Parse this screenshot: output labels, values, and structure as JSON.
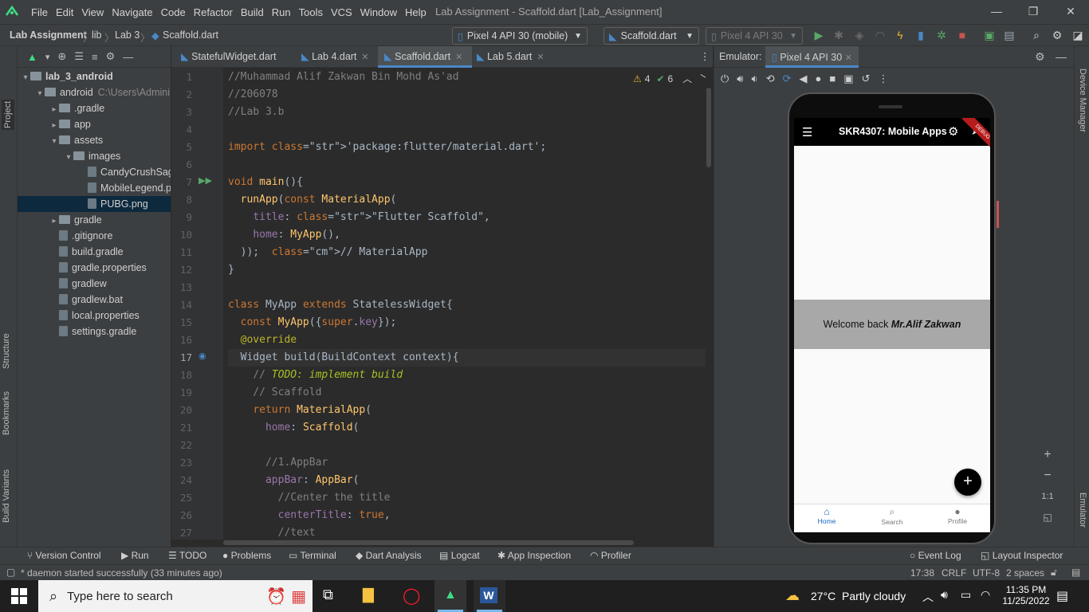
{
  "menu": [
    "File",
    "Edit",
    "View",
    "Navigate",
    "Code",
    "Refactor",
    "Build",
    "Run",
    "Tools",
    "VCS",
    "Window",
    "Help"
  ],
  "window_title": "Lab Assignment - Scaffold.dart [Lab_Assignment]",
  "breadcrumb": [
    "Lab Assignment",
    "lib",
    "Lab 3",
    "Scaffold.dart"
  ],
  "device_combo": "Pixel 4 API 30 (mobile)",
  "run_config": "Scaffold.dart",
  "device_combo2": "Pixel 4 API 30",
  "project_tree": [
    {
      "label": "lab_3_android",
      "indent": 0,
      "arrow": "▾",
      "type": "folder",
      "bold": true
    },
    {
      "label": "android",
      "hint": "C:\\Users\\Admini",
      "indent": 1,
      "arrow": "▾",
      "type": "folder"
    },
    {
      "label": ".gradle",
      "indent": 2,
      "arrow": "▸",
      "type": "folder"
    },
    {
      "label": "app",
      "indent": 2,
      "arrow": "▸",
      "type": "folder"
    },
    {
      "label": "assets",
      "indent": 2,
      "arrow": "▾",
      "type": "folder"
    },
    {
      "label": "images",
      "indent": 3,
      "arrow": "▾",
      "type": "folder"
    },
    {
      "label": "CandyCrushSag",
      "indent": 4,
      "arrow": "",
      "type": "file"
    },
    {
      "label": "MobileLegend.p",
      "indent": 4,
      "arrow": "",
      "type": "file"
    },
    {
      "label": "PUBG.png",
      "indent": 4,
      "arrow": "",
      "type": "file",
      "selected": true
    },
    {
      "label": "gradle",
      "indent": 2,
      "arrow": "▸",
      "type": "folder"
    },
    {
      "label": ".gitignore",
      "indent": 2,
      "arrow": "",
      "type": "file"
    },
    {
      "label": "build.gradle",
      "indent": 2,
      "arrow": "",
      "type": "file"
    },
    {
      "label": "gradle.properties",
      "indent": 2,
      "arrow": "",
      "type": "file"
    },
    {
      "label": "gradlew",
      "indent": 2,
      "arrow": "",
      "type": "file"
    },
    {
      "label": "gradlew.bat",
      "indent": 2,
      "arrow": "",
      "type": "file"
    },
    {
      "label": "local.properties",
      "indent": 2,
      "arrow": "",
      "type": "file"
    },
    {
      "label": "settings.gradle",
      "indent": 2,
      "arrow": "",
      "type": "file"
    }
  ],
  "editor_tabs": [
    "StatefulWidget.dart",
    "Lab 4.dart",
    "Scaffold.dart",
    "Lab 5.dart"
  ],
  "inspection": {
    "warnings": "4",
    "ok": "6"
  },
  "code_lines": [
    "//Muhammad Alif Zakwan Bin Mohd As'ad",
    "//206078",
    "//Lab 3.b",
    "",
    "import 'package:flutter/material.dart';",
    "",
    "void main(){",
    "  runApp(const MaterialApp(",
    "    title: \"Flutter Scaffold\",",
    "    home: MyApp(),",
    "  ));  // MaterialApp",
    "}",
    "",
    "class MyApp extends StatelessWidget{",
    "  const MyApp({super.key});",
    "  @override",
    "  Widget build(BuildContext context){",
    "    // TODO: implement build",
    "    // Scaffold",
    "    return MaterialApp(",
    "      home: Scaffold(",
    "",
    "      //1.AppBar",
    "      appBar: AppBar(",
    "        //Center the title",
    "        centerTitle: true,",
    "        //text"
  ],
  "emulator": {
    "label": "Emulator:",
    "tab": "Pixel 4 API 30"
  },
  "app": {
    "title": "SKR4307: Mobile Apps",
    "banner": "DEBUG",
    "welcome_prefix": "Welcome back ",
    "welcome_name": "Mr.Alif Zakwan",
    "fab": "+",
    "nav": [
      "Home",
      "Search",
      "Profile"
    ]
  },
  "zoom": {
    "plus": "+",
    "minus": "−",
    "ratio": "1:1"
  },
  "right_tabs": [
    "Device Manager",
    "Emulator"
  ],
  "left_tabs": [
    "Project",
    "Structure",
    "Bookmarks",
    "Build Variants"
  ],
  "bottom_tools": [
    "Version Control",
    "Run",
    "TODO",
    "Problems",
    "Terminal",
    "Dart Analysis",
    "Logcat",
    "App Inspection",
    "Profiler"
  ],
  "bottom_tools_right": [
    "Event Log",
    "Layout Inspector"
  ],
  "status": {
    "message": "* daemon started successfully (33 minutes ago)",
    "position": "17:38",
    "line_sep": "CRLF",
    "encoding": "UTF-8",
    "indent": "2 spaces"
  },
  "taskbar": {
    "search_placeholder": "Type here to search",
    "weather": "27°C  Partly cloudy",
    "time": "11:35 PM",
    "date": "11/25/2022"
  },
  "colors": {
    "accent": "#4a88c7",
    "bg": "#2b2b2b",
    "panel": "#3c3f41"
  }
}
